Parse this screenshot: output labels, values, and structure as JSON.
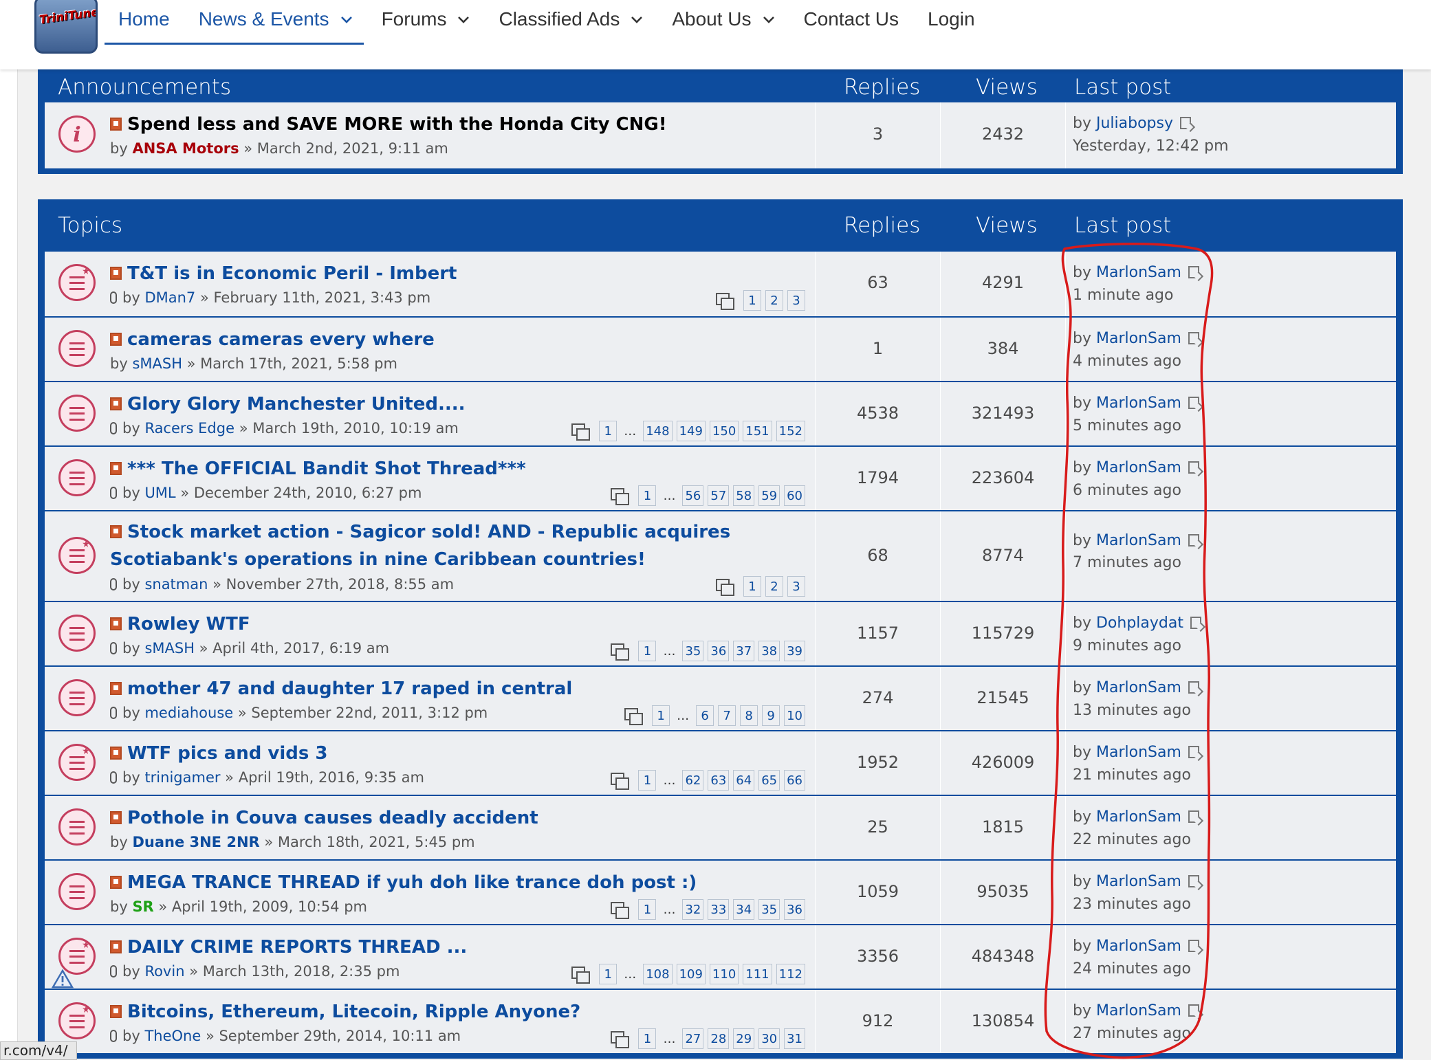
{
  "logo": {
    "text": "TriniTuner.com"
  },
  "nav": [
    {
      "label": "Home",
      "dropdown": false,
      "color": "blue"
    },
    {
      "label": "News & Events",
      "dropdown": true,
      "color": "blue"
    },
    {
      "label": "Forums",
      "dropdown": true,
      "color": "dark"
    },
    {
      "label": "Classified Ads",
      "dropdown": true,
      "color": "dark"
    },
    {
      "label": "About Us",
      "dropdown": true,
      "color": "dark"
    },
    {
      "label": "Contact Us",
      "dropdown": false,
      "color": "dark"
    },
    {
      "label": "Login",
      "dropdown": false,
      "color": "dark"
    }
  ],
  "announcements": {
    "heading": "Announcements",
    "col_replies": "Replies",
    "col_views": "Views",
    "col_last": "Last post",
    "rows": [
      {
        "title": "Spend less and SAVE MORE with the Honda City CNG!",
        "by": "by",
        "author": "ANSA Motors",
        "author_style": "red",
        "date": "» March 2nd, 2021, 9:11 am",
        "replies": "3",
        "views": "2432",
        "last_by": "by",
        "last_author": "Juliabopsy",
        "last_time": "Yesterday, 12:42 pm"
      }
    ]
  },
  "topics": {
    "heading": "Topics",
    "col_replies": "Replies",
    "col_views": "Views",
    "col_last": "Last post",
    "rows": [
      {
        "title": "T&T is in Economic Peril - Imbert",
        "author": "DMan7",
        "date": "» February 11th, 2021, 3:43 pm",
        "clip": true,
        "star": true,
        "pages": [
          "1",
          "2",
          "3"
        ],
        "replies": "63",
        "views": "4291",
        "last_author": "MarlonSam",
        "last_time": "1 minute ago"
      },
      {
        "title": "cameras cameras every where",
        "author": "sMASH",
        "date": "» March 17th, 2021, 5:58 pm",
        "clip": false,
        "star": false,
        "pages": [],
        "replies": "1",
        "views": "384",
        "last_author": "MarlonSam",
        "last_time": "4 minutes ago"
      },
      {
        "title": "Glory Glory Manchester United....",
        "author": "Racers Edge",
        "date": "» March 19th, 2010, 10:19 am",
        "clip": true,
        "star": false,
        "pages": [
          "1",
          "…",
          "148",
          "149",
          "150",
          "151",
          "152"
        ],
        "replies": "4538",
        "views": "321493",
        "last_author": "MarlonSam",
        "last_time": "5 minutes ago"
      },
      {
        "title": "*** The OFFICIAL Bandit Shot Thread***",
        "author": "UML",
        "date": "» December 24th, 2010, 6:27 pm",
        "clip": true,
        "star": false,
        "pages": [
          "1",
          "…",
          "56",
          "57",
          "58",
          "59",
          "60"
        ],
        "replies": "1794",
        "views": "223604",
        "last_author": "MarlonSam",
        "last_time": "6 minutes ago"
      },
      {
        "title": "Stock market action - Sagicor sold! AND - Republic acquires Scotiabank's operations in nine Caribbean countries!",
        "author": "snatman",
        "date": "» November 27th, 2018, 8:55 am",
        "clip": true,
        "star": true,
        "pages": [
          "1",
          "2",
          "3"
        ],
        "replies": "68",
        "views": "8774",
        "last_author": "MarlonSam",
        "last_time": "7 minutes ago"
      },
      {
        "title": "Rowley WTF",
        "author": "sMASH",
        "date": "» April 4th, 2017, 6:19 am",
        "clip": true,
        "star": false,
        "pages": [
          "1",
          "…",
          "35",
          "36",
          "37",
          "38",
          "39"
        ],
        "replies": "1157",
        "views": "115729",
        "last_author": "Dohplaydat",
        "last_time": "9 minutes ago"
      },
      {
        "title": "mother 47 and daughter 17 raped in central",
        "author": "mediahouse",
        "date": "» September 22nd, 2011, 3:12 pm",
        "clip": true,
        "star": false,
        "pages": [
          "1",
          "…",
          "6",
          "7",
          "8",
          "9",
          "10"
        ],
        "replies": "274",
        "views": "21545",
        "last_author": "MarlonSam",
        "last_time": "13 minutes ago"
      },
      {
        "title": "WTF pics and vids 3",
        "author": "trinigamer",
        "date": "» April 19th, 2016, 9:35 am",
        "clip": true,
        "star": true,
        "pages": [
          "1",
          "…",
          "62",
          "63",
          "64",
          "65",
          "66"
        ],
        "replies": "1952",
        "views": "426009",
        "last_author": "MarlonSam",
        "last_time": "21 minutes ago"
      },
      {
        "title": "Pothole in Couva causes deadly accident",
        "author": "Duane 3NE 2NR",
        "author_style": "bold",
        "date": "» March 18th, 2021, 5:45 pm",
        "clip": false,
        "star": false,
        "pages": [],
        "replies": "25",
        "views": "1815",
        "last_author": "MarlonSam",
        "last_time": "22 minutes ago"
      },
      {
        "title": "MEGA TRANCE THREAD if yuh doh like trance doh post :)",
        "author": "SR",
        "author_style": "green",
        "date": "» April 19th, 2009, 10:54 pm",
        "clip": false,
        "star": false,
        "pages": [
          "1",
          "…",
          "32",
          "33",
          "34",
          "35",
          "36"
        ],
        "replies": "1059",
        "views": "95035",
        "last_author": "MarlonSam",
        "last_time": "23 minutes ago"
      },
      {
        "title": "DAILY CRIME REPORTS THREAD ...",
        "author": "Rovin",
        "date": "» March 13th, 2018, 2:35 pm",
        "clip": true,
        "star": true,
        "warn": true,
        "pages": [
          "1",
          "…",
          "108",
          "109",
          "110",
          "111",
          "112"
        ],
        "replies": "3356",
        "views": "484348",
        "last_author": "MarlonSam",
        "last_time": "24 minutes ago"
      },
      {
        "title": "Bitcoins, Ethereum, Litecoin, Ripple Anyone?",
        "author": "TheOne",
        "date": "» September 29th, 2014, 10:11 am",
        "clip": true,
        "star": true,
        "pages": [
          "1",
          "…",
          "27",
          "28",
          "29",
          "30",
          "31"
        ],
        "replies": "912",
        "views": "130854",
        "last_author": "MarlonSam",
        "last_time": "27 minutes ago"
      }
    ]
  },
  "by_label": "by",
  "statusbar": "r.com/v4/",
  "colors": {
    "brand_blue": "#0d4c9e",
    "author_red": "#a8000a",
    "author_green": "#1ea116",
    "annotation_red": "#d81b1b"
  }
}
